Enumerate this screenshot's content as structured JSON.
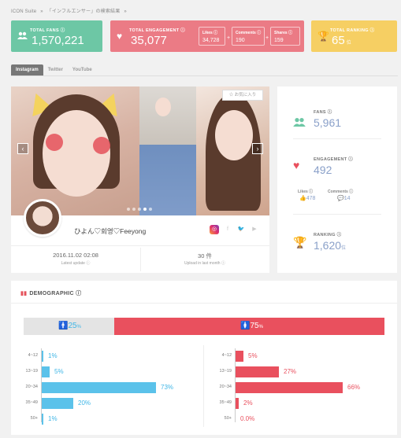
{
  "breadcrumb": [
    "ICON Suite",
    "»",
    "「インフルエンサー」の検索結果",
    "»"
  ],
  "kpis": {
    "fans": {
      "label": "TOTAL FANS",
      "value": "1,570,221"
    },
    "engagement": {
      "label": "TOTAL ENGAGEMENT",
      "value": "35,077",
      "likes": {
        "label": "Likes",
        "value": "34,728"
      },
      "comments": {
        "label": "Comments",
        "value": "190"
      },
      "shares": {
        "label": "Shares",
        "value": "159"
      }
    },
    "ranking": {
      "label": "TOTAL RANKING",
      "value": "65",
      "unit": "位"
    }
  },
  "tabs": [
    "Instagram",
    "Twitter",
    "YouTube"
  ],
  "profile": {
    "favorite_label": "☆ お気に入り",
    "name": "ひよん♡회영♡Feeyong",
    "last_update": {
      "value": "2016.11.02 02:08",
      "label": "Latest update"
    },
    "uploads": {
      "value": "30 件",
      "label": "Upload in last month"
    },
    "carousel_index": 3
  },
  "stats": {
    "fans": {
      "label": "FANS",
      "value": "5,961"
    },
    "engagement": {
      "label": "ENGAGEMENT",
      "value": "492",
      "likes": {
        "label": "Likes",
        "value": "478"
      },
      "comments": {
        "label": "Comments",
        "value": "14"
      }
    },
    "ranking": {
      "label": "RANKING",
      "value": "1,620",
      "unit": "位"
    }
  },
  "demographic": {
    "title": "DEMOGRAPHIC",
    "gender": {
      "male": {
        "value": "25",
        "unit": "%"
      },
      "female": {
        "value": "75",
        "unit": "%"
      }
    },
    "colors": {
      "male": "#5bc2ea",
      "female": "#e9505e"
    }
  },
  "chart_data": [
    {
      "type": "bar",
      "title": "",
      "categories": [
        "4~12",
        "13~19",
        "20~34",
        "35~49",
        "50+"
      ],
      "series": [
        {
          "name": "",
          "values": [
            1,
            5,
            73,
            20,
            1
          ]
        }
      ],
      "value_labels": [
        "1%",
        "5%",
        "73%",
        "20%",
        "1%"
      ]
    },
    {
      "type": "bar",
      "title": "",
      "categories": [
        "4~12",
        "13~19",
        "20~34",
        "35~49",
        "50+"
      ],
      "series": [
        {
          "name": "",
          "values": [
            5,
            27,
            66,
            2,
            0
          ]
        }
      ],
      "value_labels": [
        "5%",
        "27%",
        "66%",
        "2%",
        "0.0%"
      ]
    }
  ]
}
